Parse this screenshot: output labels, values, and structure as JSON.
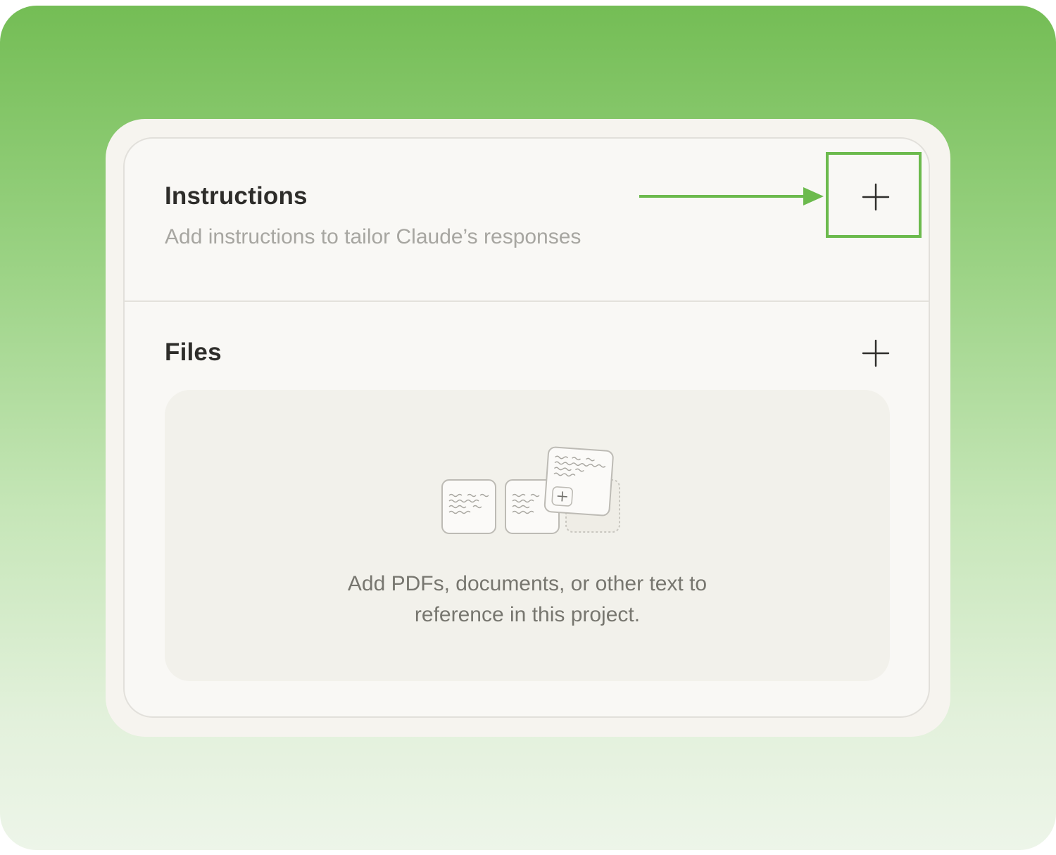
{
  "instructions": {
    "title": "Instructions",
    "subtitle": "Add instructions to tailor Claude’s responses",
    "add_icon": "plus-icon"
  },
  "files": {
    "title": "Files",
    "add_icon": "plus-icon",
    "empty_state": {
      "illustration": "documents-illustration",
      "text_line1": "Add PDFs, documents, or other text to",
      "text_line2": "reference in this project."
    }
  },
  "annotation": {
    "arrow_color": "#6cba4d",
    "highlight_color": "#6cba4d"
  },
  "colors": {
    "background_gradient_top": "#74bd55",
    "background_gradient_bottom": "#edf5e9",
    "panel_background": "#f9f8f5",
    "dropzone_background": "#f2f1eb"
  }
}
